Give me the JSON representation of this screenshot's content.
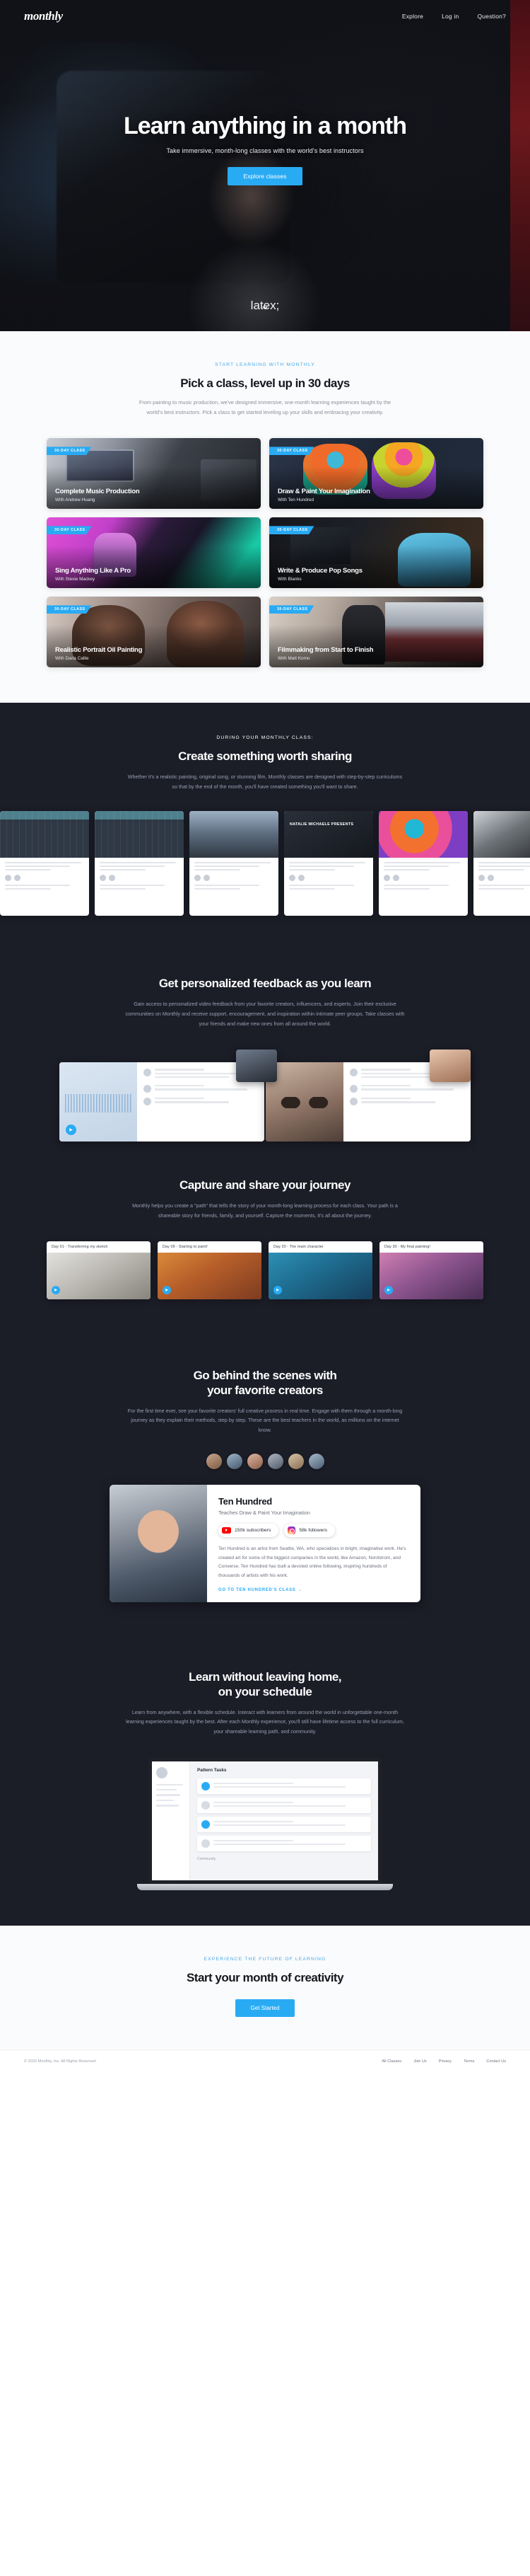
{
  "nav": {
    "brand": "monthly",
    "links": [
      "Explore",
      "Log in",
      "Question?"
    ]
  },
  "hero": {
    "title": "Learn anything in a month",
    "subtitle": "Take immersive, month-long classes with the world's best instructors",
    "cta": "Explore classes",
    "scroll_icon": "chevron-down-icon"
  },
  "classes_section": {
    "eyebrow": "START LEARNING WITH MONTHLY",
    "heading": "Pick a class, level up in 30 days",
    "paragraph": "From painting to music production, we've designed immersive, one-month learning experiences taught by the world's best instructors. Pick a class to get started leveling up your skills and embracing your creativity.",
    "badge": "30-DAY CLASS",
    "cards": [
      {
        "title": "Complete Music Production",
        "by": "With Andrew Huang",
        "art": "img-music"
      },
      {
        "title": "Draw & Paint Your Imagination",
        "by": "With Ten Hundred",
        "art": "img-draw"
      },
      {
        "title": "Sing Anything Like A Pro",
        "by": "With Stevie Mackey",
        "art": "img-sing"
      },
      {
        "title": "Write & Produce Pop Songs",
        "by": "With Blanks",
        "art": "img-pop"
      },
      {
        "title": "Realistic Portrait Oil Painting",
        "by": "With Daria Callie",
        "art": "img-oil"
      },
      {
        "title": "Filmmaking from Start to Finish",
        "by": "With Matt Komo",
        "art": "img-film"
      }
    ]
  },
  "create_section": {
    "eyebrow": "DURING YOUR MONTHLY CLASS:",
    "heading": "Create something worth sharing",
    "paragraph": "Whether it's a realistic painting, original song, or stunning film, Monthly classes are designed with step-by-step curriculums so that by the end of the month, you'll have created something you'll want to share.",
    "shots": [
      {
        "media": "m-daw",
        "caption": ""
      },
      {
        "media": "m-daw",
        "caption": ""
      },
      {
        "media": "m-run",
        "caption": ""
      },
      {
        "media": "m-nat",
        "caption": "NATALIE MICHAELE PRESENTS"
      },
      {
        "media": "m-mural",
        "caption": ""
      },
      {
        "media": "m-bw",
        "caption": ""
      }
    ]
  },
  "feedback_section": {
    "heading": "Get personalized feedback as you learn",
    "paragraph": "Gain access to personalized video feedback from your favorite creators, influencers, and experts. Join their exclusive communities on Monthly and receive support, encouragement, and inspiration within intimate peer groups. Take classes with your friends and make new ones from all around the world.",
    "play_icon": "play-icon"
  },
  "journey_section": {
    "heading": "Capture and share your journey",
    "paragraph": "Monthly helps you create a \"path\" that tells the story of your month-long learning process for each class. Your path is a shareable story for friends, family, and yourself. Capture the moments, it's all about the journey.",
    "cards": [
      {
        "label": "Day 01 - Transferring my sketch",
        "art": "j1"
      },
      {
        "label": "Day 09 - Starting to paint!",
        "art": "j2"
      },
      {
        "label": "Day 20 - The main character",
        "art": "j3"
      },
      {
        "label": "Day 30 - My final painting!",
        "art": "j4"
      }
    ]
  },
  "behind_section": {
    "heading_line1": "Go behind the scenes with",
    "heading_line2": "your favorite creators",
    "paragraph": "For the first time ever, see your favorite creators' full creative process in real time. Engage with them through a month-long journey as they explain their methods, step by step. These are the best teachers in the world, as millions on the internet know.",
    "creator": {
      "name": "Ten Hundred",
      "role": "Teaches Draw & Paint Your Imagination",
      "youtube_stat": "150k subscribers",
      "instagram_stat": "58k followers",
      "bio": "Ten Hundred is an artist from Seattle, WA, who specializes in bright, imaginative work. He's created art for some of the biggest companies in the world, like Amazon, Nordstrom, and Converse. Ten Hundred has built a devoted online following, inspiring hundreds of thousands of artists with his work.",
      "link": "GO TO TEN HUNDRED'S CLASS →"
    }
  },
  "home_section": {
    "heading_line1": "Learn without leaving home,",
    "heading_line2": "on your schedule",
    "paragraph": "Learn from anywhere, with a flexible schedule. Interact with learners from around the world in unforgettable one-month learning experiences taught by the best. After each Monthly experience, you'll still have lifetime access to the full curriculum, your shareable learning path, and community.",
    "app": {
      "title": "Pattern Tasks",
      "footer": "Community"
    }
  },
  "cta_section": {
    "eyebrow": "EXPERIENCE THE FUTURE OF LEARNING",
    "heading": "Start your month of creativity",
    "button": "Get Started"
  },
  "footer": {
    "copyright": "© 2020 Monthly, Inc. All Rights Reserved.",
    "links": [
      "All Classes",
      "Join Us",
      "Privacy",
      "Terms",
      "Contact Us"
    ]
  }
}
